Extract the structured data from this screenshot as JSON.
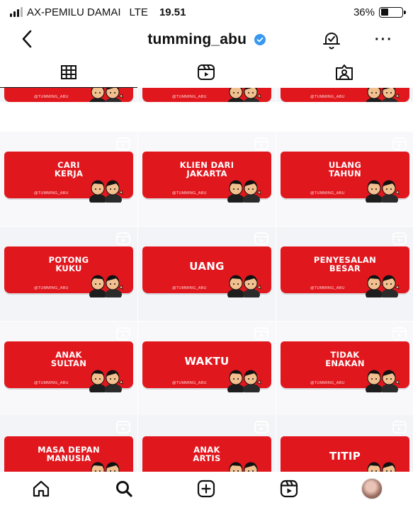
{
  "status_bar": {
    "carrier": "AX-PEMILU DAMAI",
    "network": "LTE",
    "time": "19.51",
    "battery_percent": "36%",
    "battery_level": 0.36
  },
  "header": {
    "username": "tumming_abu",
    "verified": true,
    "more_label": "···"
  },
  "tabs": [
    {
      "name": "grid-icon",
      "active": true
    },
    {
      "name": "reels-icon",
      "active": false
    },
    {
      "name": "tagged-icon",
      "active": false
    }
  ],
  "accent_color": "#e1171e",
  "watermark": "@TUMMING_ABU",
  "posts": [
    {
      "caption": ""
    },
    {
      "caption": ""
    },
    {
      "caption": ""
    },
    {
      "caption": "CARI\nKERJA"
    },
    {
      "caption": "KLIEN DARI\nJAKARTA"
    },
    {
      "caption": "ULANG\nTAHUN"
    },
    {
      "caption": "POTONG\nKUKU"
    },
    {
      "caption": "UANG"
    },
    {
      "caption": "PENYESALAN\nBESAR"
    },
    {
      "caption": "ANAK\nSULTAN"
    },
    {
      "caption": "WAKTU"
    },
    {
      "caption": "TIDAK\nENAKAN"
    },
    {
      "caption": "MASA DEPAN\nMANUSIA"
    },
    {
      "caption": "ANAK\nARTIS"
    },
    {
      "caption": "TITIP"
    }
  ],
  "bottom_nav": [
    "home-icon",
    "search-icon",
    "create-icon",
    "reels-icon",
    "profile-avatar"
  ]
}
